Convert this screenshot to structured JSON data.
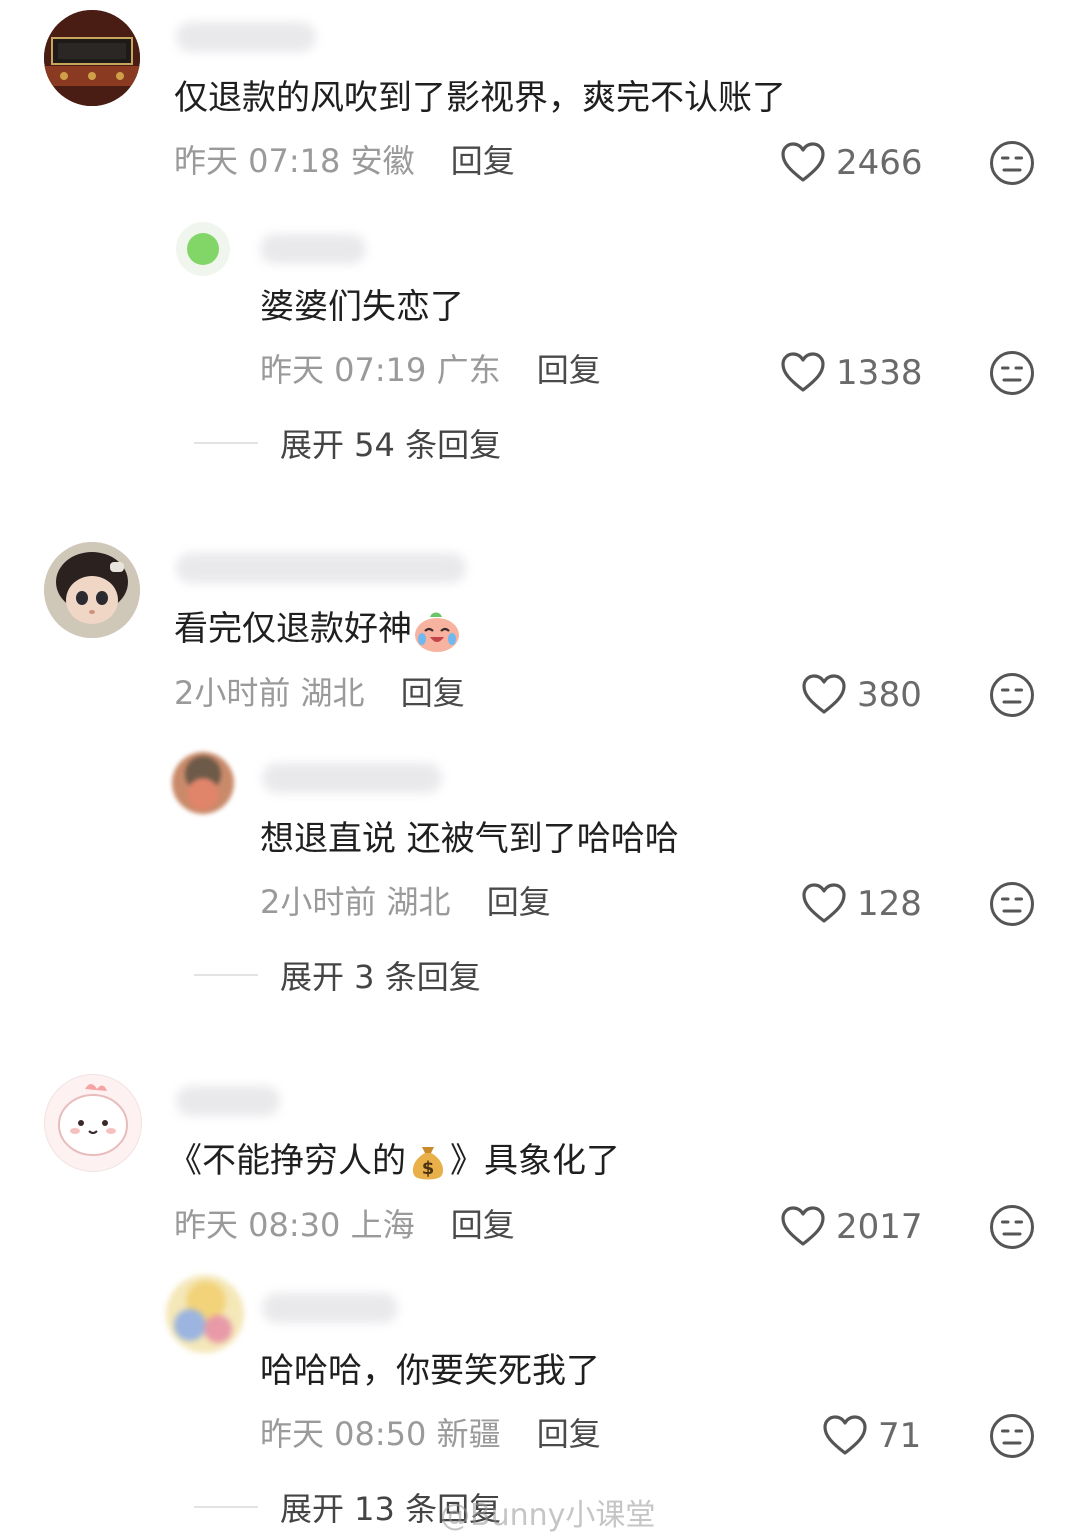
{
  "comments": [
    {
      "text": "仅退款的风吹到了影视界，爽完不认账了",
      "time": "昨天 07:18",
      "location": "安徽",
      "reply_label": "回复",
      "likes": "2466",
      "replies": [
        {
          "text": "婆婆们失恋了",
          "time": "昨天 07:19",
          "location": "广东",
          "reply_label": "回复",
          "likes": "1338"
        }
      ],
      "expand_label": "展开 54 条回复"
    },
    {
      "text": "看完仅退款好神",
      "emoji": "crying-laughing-emoji",
      "time": "2小时前",
      "location": "湖北",
      "reply_label": "回复",
      "likes": "380",
      "replies": [
        {
          "text": "想退直说 还被气到了哈哈哈",
          "time": "2小时前",
          "location": "湖北",
          "reply_label": "回复",
          "likes": "128"
        }
      ],
      "expand_label": "展开 3 条回复"
    },
    {
      "text_before": "《不能挣穷人的",
      "emoji": "money-bag-emoji",
      "text_after": "》具象化了",
      "time": "昨天 08:30",
      "location": "上海",
      "reply_label": "回复",
      "likes": "2017",
      "replies": [
        {
          "text": "哈哈哈，你要笑死我了",
          "time": "昨天 08:50",
          "location": "新疆",
          "reply_label": "回复",
          "likes": "71"
        }
      ],
      "expand_label": "展开 13 条回复"
    }
  ],
  "watermark": "@Bunny小课堂",
  "colors": {
    "text": "#1f1f1f",
    "meta": "#9a9a9a",
    "icon": "#555555",
    "background": "#ffffff"
  }
}
